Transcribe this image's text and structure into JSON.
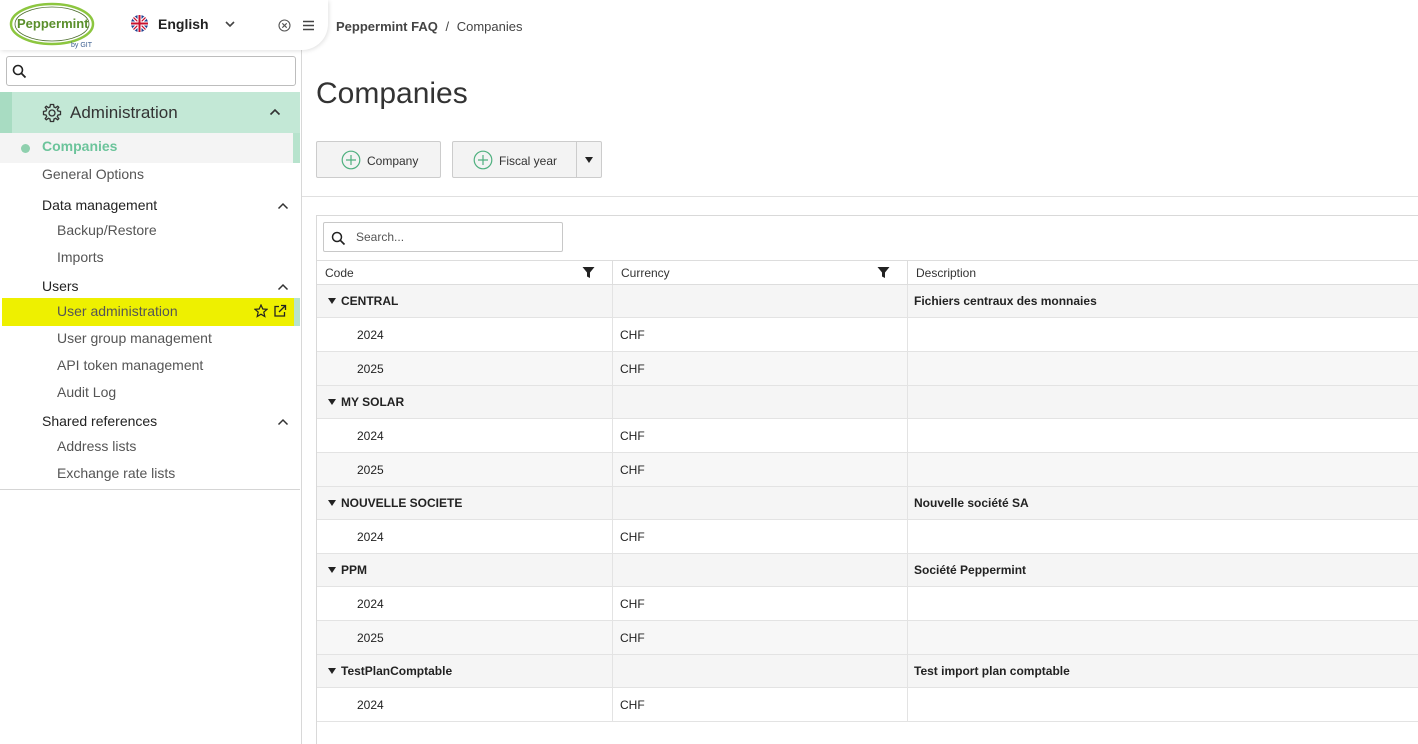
{
  "brand": {
    "name": "Peppermint",
    "by": "by GIT"
  },
  "language": {
    "selected": "English"
  },
  "sidebar": {
    "search_placeholder": "",
    "section_title": "Administration",
    "active_item": "Companies",
    "items": {
      "general_options": "General Options",
      "data_management": "Data management",
      "backup_restore": "Backup/Restore",
      "imports": "Imports",
      "users": "Users",
      "user_administration": "User administration",
      "user_group_management": "User group management",
      "api_token_management": "API token management",
      "audit_log": "Audit Log",
      "shared_references": "Shared references",
      "address_lists": "Address lists",
      "exchange_rate_lists": "Exchange rate lists"
    }
  },
  "breadcrumb": {
    "root": "Peppermint FAQ",
    "separator": "/",
    "current": "Companies"
  },
  "page": {
    "title": "Companies"
  },
  "toolbar": {
    "company_label": "Company",
    "fiscal_year_label": "Fiscal year"
  },
  "grid": {
    "search_placeholder": "Search...",
    "columns": {
      "code": "Code",
      "currency": "Currency",
      "description": "Description"
    },
    "groups": [
      {
        "code": "CENTRAL",
        "description": "Fichiers centraux des monnaies",
        "years": [
          {
            "year": "2024",
            "currency": "CHF"
          },
          {
            "year": "2025",
            "currency": "CHF"
          }
        ]
      },
      {
        "code": "MY SOLAR",
        "description": "",
        "years": [
          {
            "year": "2024",
            "currency": "CHF"
          },
          {
            "year": "2025",
            "currency": "CHF"
          }
        ]
      },
      {
        "code": "NOUVELLE SOCIETE",
        "description": "Nouvelle société SA",
        "years": [
          {
            "year": "2024",
            "currency": "CHF"
          }
        ]
      },
      {
        "code": "PPM",
        "description": "Société Peppermint",
        "years": [
          {
            "year": "2024",
            "currency": "CHF"
          },
          {
            "year": "2025",
            "currency": "CHF"
          }
        ]
      },
      {
        "code": "TestPlanComptable",
        "description": "Test import plan comptable",
        "years": [
          {
            "year": "2024",
            "currency": "CHF"
          }
        ]
      }
    ]
  },
  "colors": {
    "accent_green": "#6cc49b",
    "section_bg": "#c3e8d6",
    "highlight_yellow": "#eef000"
  }
}
